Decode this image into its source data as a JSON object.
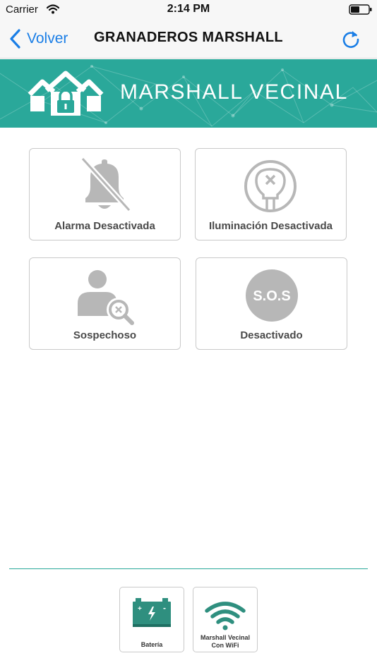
{
  "status_bar": {
    "carrier": "Carrier",
    "time": "2:14 PM"
  },
  "nav": {
    "back_label": "Volver",
    "title": "GRANADEROS MARSHALL"
  },
  "banner": {
    "title": "MARSHALL VECINAL"
  },
  "tiles": [
    {
      "label": "Alarma Desactivada",
      "icon": "bell-off-icon"
    },
    {
      "label": "Iluminación Desactivada",
      "icon": "lightbulb-off-icon"
    },
    {
      "label": "Sospechoso",
      "icon": "suspect-search-icon"
    },
    {
      "label": "Desactivado",
      "icon": "sos-icon",
      "icon_text": "S.O.S"
    }
  ],
  "bottom_buttons": [
    {
      "label_line1": "Batería",
      "icon": "battery-icon"
    },
    {
      "label_line1": "Marshall Vecinal",
      "label_line2": "Con WiFi",
      "icon": "wifi-icon"
    }
  ],
  "colors": {
    "accent": "#2aa89a",
    "link": "#1a7ee6",
    "icon_gray": "#b7b7b7",
    "label_gray": "#4a4a4a"
  }
}
